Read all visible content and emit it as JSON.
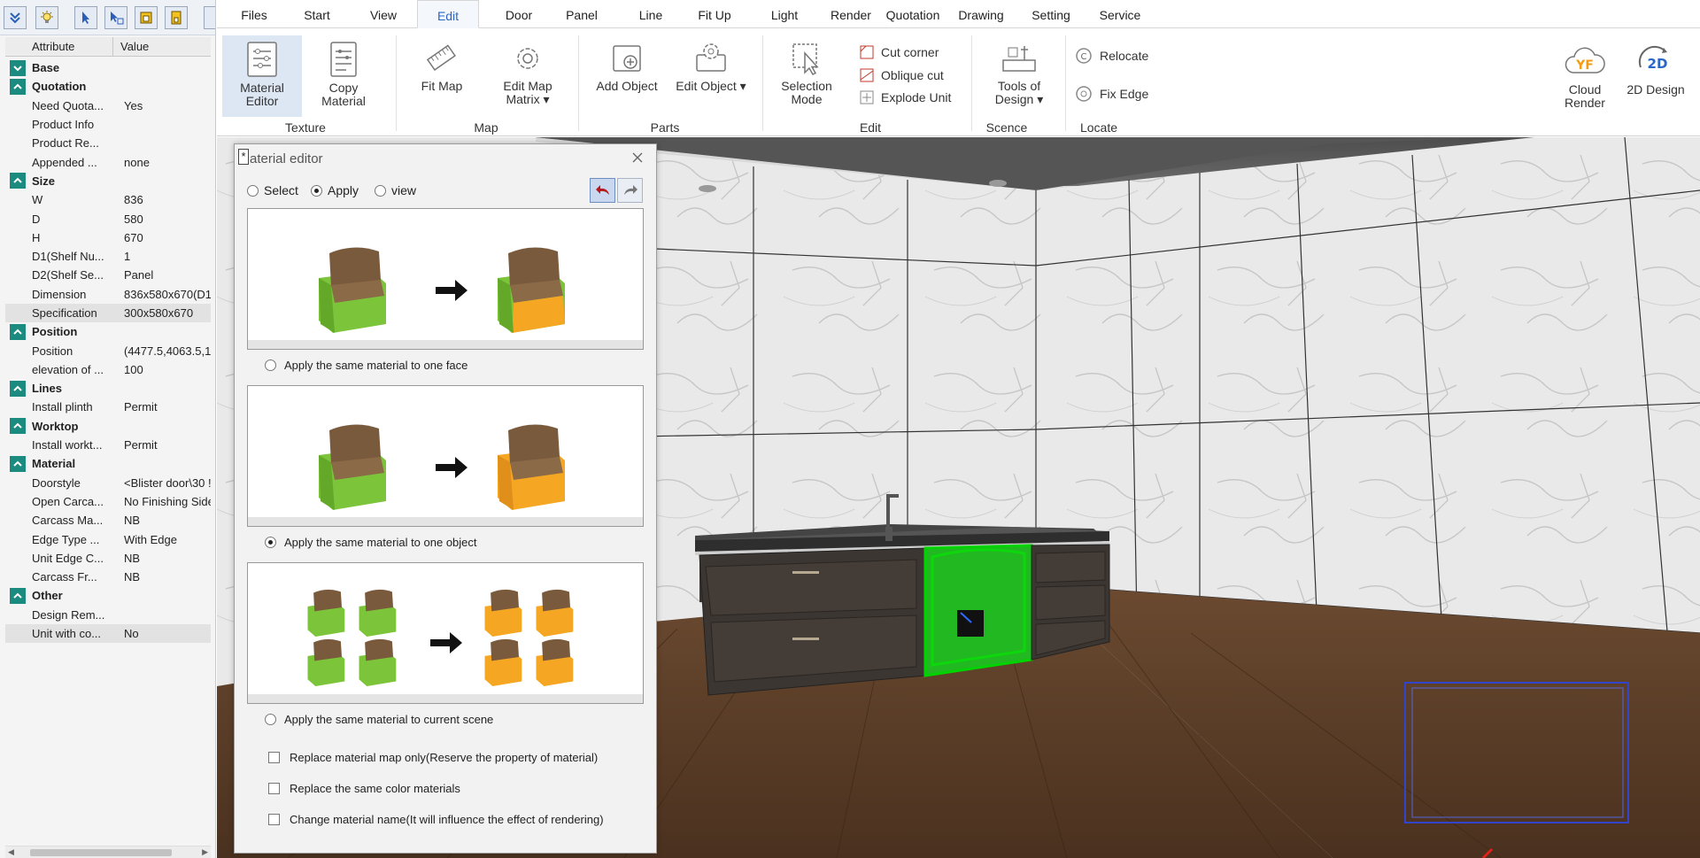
{
  "left_toolbar": {
    "icons": [
      "collapse-icon",
      "lightbulb-icon",
      "select-arrow-icon",
      "select-filter-icon",
      "lock-icon",
      "unlock-icon"
    ]
  },
  "properties": {
    "header": {
      "attribute": "Attribute",
      "value": "Value"
    },
    "rows": [
      {
        "type": "group",
        "label": "Base",
        "expanded": false
      },
      {
        "type": "group",
        "label": "Quotation",
        "expanded": true
      },
      {
        "type": "prop",
        "name": "Need Quota...",
        "value": "Yes"
      },
      {
        "type": "prop",
        "name": "Product Info",
        "value": ""
      },
      {
        "type": "prop",
        "name": "Product Re...",
        "value": ""
      },
      {
        "type": "prop",
        "name": "Appended ...",
        "value": "none"
      },
      {
        "type": "group",
        "label": "Size",
        "expanded": true
      },
      {
        "type": "prop",
        "name": "W",
        "value": "836"
      },
      {
        "type": "prop",
        "name": "D",
        "value": "580"
      },
      {
        "type": "prop",
        "name": "H",
        "value": "670"
      },
      {
        "type": "prop",
        "name": "D1(Shelf Nu...",
        "value": "1"
      },
      {
        "type": "prop",
        "name": "D2(Shelf Se...",
        "value": "Panel"
      },
      {
        "type": "prop",
        "name": "Dimension",
        "value": "836x580x670(D1"
      },
      {
        "type": "prop",
        "name": "Specification",
        "value": "300x580x670",
        "selected": true
      },
      {
        "type": "group",
        "label": "Position",
        "expanded": true
      },
      {
        "type": "prop",
        "name": "Position",
        "value": "(4477.5,4063.5,1"
      },
      {
        "type": "prop",
        "name": "elevation of ...",
        "value": "100"
      },
      {
        "type": "group",
        "label": "Lines",
        "expanded": true
      },
      {
        "type": "prop",
        "name": "Install plinth",
        "value": "Permit"
      },
      {
        "type": "group",
        "label": "Worktop",
        "expanded": true
      },
      {
        "type": "prop",
        "name": "Install workt...",
        "value": "Permit"
      },
      {
        "type": "group",
        "label": "Material",
        "expanded": true
      },
      {
        "type": "prop",
        "name": "Doorstyle",
        "value": "<Blister door\\30 !"
      },
      {
        "type": "prop",
        "name": "Open Carca...",
        "value": "No Finishing Side"
      },
      {
        "type": "prop",
        "name": "Carcass Ma...",
        "value": "NB"
      },
      {
        "type": "prop",
        "name": "Edge Type ...",
        "value": "With Edge"
      },
      {
        "type": "prop",
        "name": "Unit Edge C...",
        "value": "NB"
      },
      {
        "type": "prop",
        "name": "Carcass Fr...",
        "value": "NB"
      },
      {
        "type": "group",
        "label": "Other",
        "expanded": true
      },
      {
        "type": "prop",
        "name": "Design Rem...",
        "value": ""
      },
      {
        "type": "prop",
        "name": "Unit with co...",
        "value": "No",
        "selected": true
      }
    ]
  },
  "menu": {
    "tabs": [
      "Files",
      "Start",
      "View",
      "Edit",
      "Door",
      "Panel",
      "Line",
      "Fit Up",
      "Light",
      "Render",
      "Quotation",
      "Drawing",
      "Setting",
      "Service"
    ],
    "active": "Edit"
  },
  "ribbon": {
    "material_editor": "Material Editor",
    "material_editor_l1": "Material",
    "material_editor_l2": "Editor",
    "copy_material_l1": "Copy",
    "copy_material_l2": "Material",
    "fit_map": "Fit Map",
    "edit_map_matrix_l1": "Edit Map",
    "edit_map_matrix_l2": "Matrix",
    "add_object": "Add Object",
    "edit_object": "Edit Object",
    "selection_mode_l1": "Selection",
    "selection_mode_l2": "Mode",
    "cut_corner": "Cut corner",
    "oblique_cut": "Oblique cut",
    "explode_unit": "Explode Unit",
    "tools_of_design_l1": "Tools of",
    "tools_of_design_l2": "Design",
    "relocate": "Relocate",
    "fix_edge": "Fix Edge",
    "cloud_render_l1": "Cloud",
    "cloud_render_l2": "Render",
    "cloud_logo": "YF",
    "design_2d_badge": "2D",
    "design_2d": "2D Design",
    "groups": {
      "texture": "Texture",
      "map": "Map",
      "parts": "Parts",
      "edit": "Edit",
      "scence": "Scence",
      "locate": "Locate"
    }
  },
  "dialog": {
    "star": "*",
    "title": "aterial editor",
    "modes": {
      "select": "Select",
      "apply": "Apply",
      "view": "view",
      "selected": "Apply"
    },
    "option_one_face": "Apply the same material to one face",
    "option_one_object": "Apply the same material to one object",
    "option_scene": "Apply the same material to current scene",
    "selected_option": "one_object",
    "chk_replace_map": "Replace material map only(Reserve the property of material)",
    "chk_same_color": "Replace the same color materials",
    "chk_change_name": "Change material name(It will influence the effect of rendering)"
  },
  "colors": {
    "accent_blue": "#2a66c8",
    "teal_expander": "#1b8a7f",
    "selected_cabinet": "#22b822",
    "chair_green": "#7cc43a",
    "chair_orange": "#f5a623",
    "cabinet_dark": "#3c3632",
    "floor_wood": "#5a3d27"
  }
}
